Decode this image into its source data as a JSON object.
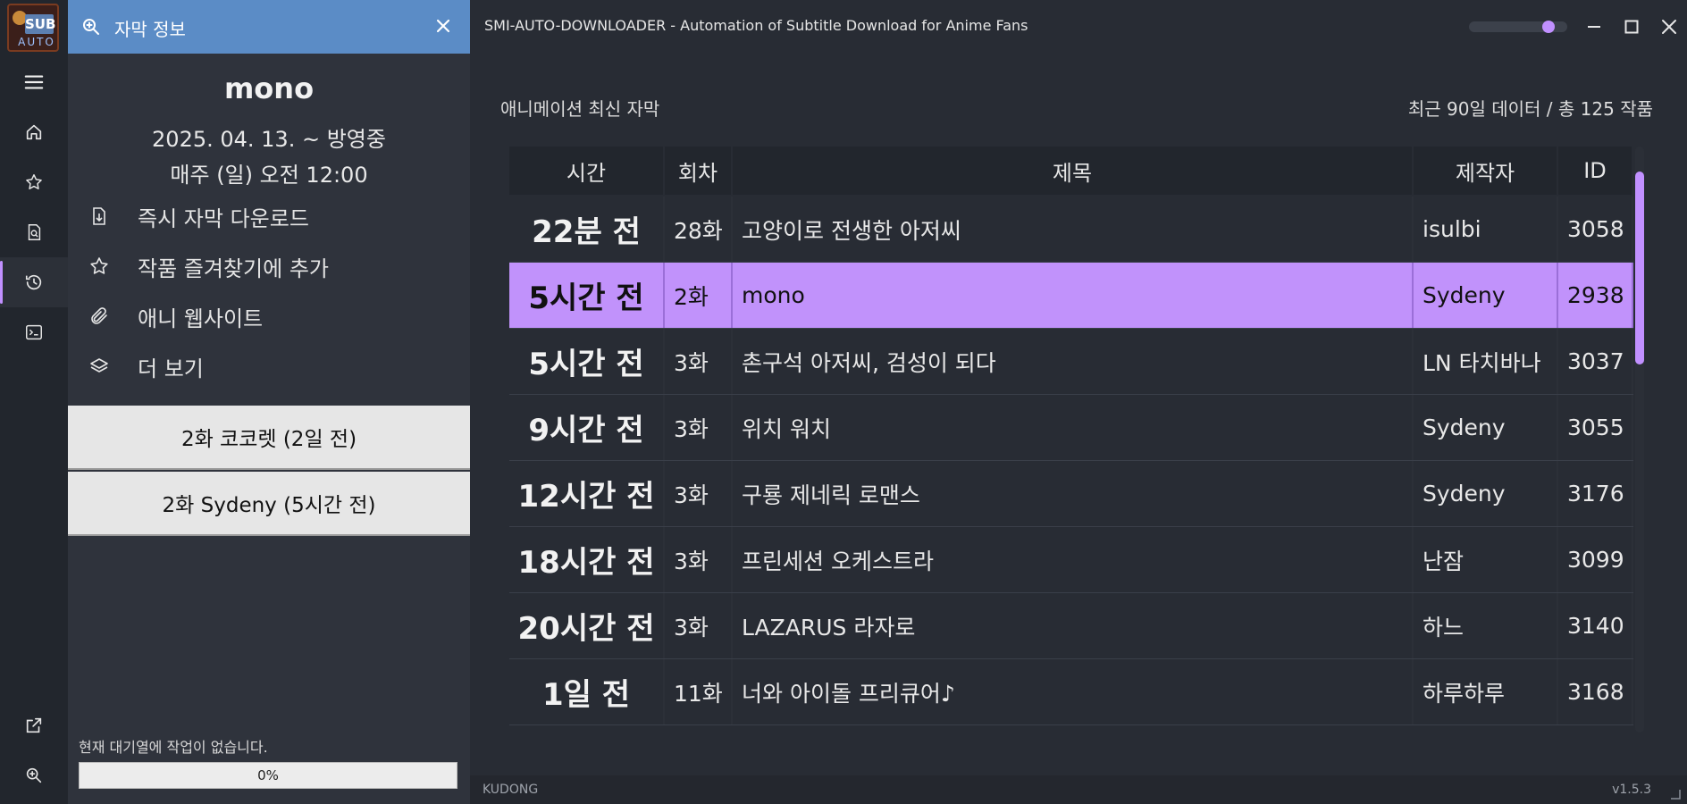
{
  "window": {
    "title": "SMI-AUTO-DOWNLOADER - Automation of Subtitle Download for Anime Fans",
    "zoom_level": 0.85
  },
  "logo": {
    "line1": "SUB",
    "line2": "AUTO"
  },
  "nav": {
    "items": [
      {
        "name": "menu",
        "icon": "hamburger-icon",
        "active": false
      },
      {
        "name": "home",
        "icon": "home-icon",
        "active": false
      },
      {
        "name": "favorites",
        "icon": "star-icon",
        "active": false
      },
      {
        "name": "search",
        "icon": "search-doc-icon",
        "active": false
      },
      {
        "name": "recent",
        "icon": "history-icon",
        "active": true
      },
      {
        "name": "terminal",
        "icon": "terminal-icon",
        "active": false
      },
      {
        "name": "external",
        "icon": "external-link-icon",
        "active": false
      },
      {
        "name": "zoom",
        "icon": "zoom-icon",
        "active": false
      }
    ]
  },
  "search": {
    "value": "자막 정보"
  },
  "anime": {
    "title": "mono",
    "date": "2025. 04. 13. ~ 방영중",
    "schedule": "매주 (일) 오전 12:00",
    "actions": [
      {
        "label": "즉시 자막 다운로드",
        "icon": "download-file-icon"
      },
      {
        "label": "작품 즐겨찾기에 추가",
        "icon": "star-icon"
      },
      {
        "label": "애니 웹사이트",
        "icon": "paperclip-icon"
      },
      {
        "label": "더 보기",
        "icon": "layers-icon"
      }
    ],
    "subtitles": [
      {
        "label": "2화 코코렛 (2일 전)"
      },
      {
        "label": "2화 Sydeny (5시간 전)"
      }
    ]
  },
  "queue": {
    "status": "현재 대기열에 작업이 없습니다.",
    "progress": 0,
    "progress_label": "0%"
  },
  "section": {
    "title": "애니메이션 최신 자막",
    "meta": "최근 90일 데이터 / 총 125 작품"
  },
  "table": {
    "headers": [
      "시간",
      "회차",
      "제목",
      "제작자",
      "ID"
    ],
    "rows": [
      {
        "time": "22분 전",
        "ep": "28화",
        "title": "고양이로 전생한 아저씨",
        "maker": "isulbi",
        "id": "3058",
        "selected": false
      },
      {
        "time": "5시간 전",
        "ep": "2화",
        "title": "mono",
        "maker": "Sydeny",
        "id": "2938",
        "selected": true
      },
      {
        "time": "5시간 전",
        "ep": "3화",
        "title": "촌구석 아저씨, 검성이 되다",
        "maker": "LN 타치바나",
        "id": "3037",
        "selected": false
      },
      {
        "time": "9시간 전",
        "ep": "3화",
        "title": "위치 워치",
        "maker": "Sydeny",
        "id": "3055",
        "selected": false
      },
      {
        "time": "12시간 전",
        "ep": "3화",
        "title": "구룡 제네릭 로맨스",
        "maker": "Sydeny",
        "id": "3176",
        "selected": false
      },
      {
        "time": "18시간 전",
        "ep": "3화",
        "title": "프린세션 오케스트라",
        "maker": "난잠",
        "id": "3099",
        "selected": false
      },
      {
        "time": "20시간 전",
        "ep": "3화",
        "title": "LAZARUS 라자로",
        "maker": "하느",
        "id": "3140",
        "selected": false
      },
      {
        "time": "1일 전",
        "ep": "11화",
        "title": "너와 아이돌 프리큐어♪",
        "maker": "하루하루",
        "id": "3168",
        "selected": false
      }
    ],
    "scroll_position": 0.0,
    "scroll_visible_fraction": 0.33
  },
  "status": {
    "left": "KUDONG",
    "right": "v1.5.3"
  },
  "colors": {
    "accent": "#c190ff",
    "search_bar": "#5b8cc6",
    "selected_row": "#c192fb"
  }
}
